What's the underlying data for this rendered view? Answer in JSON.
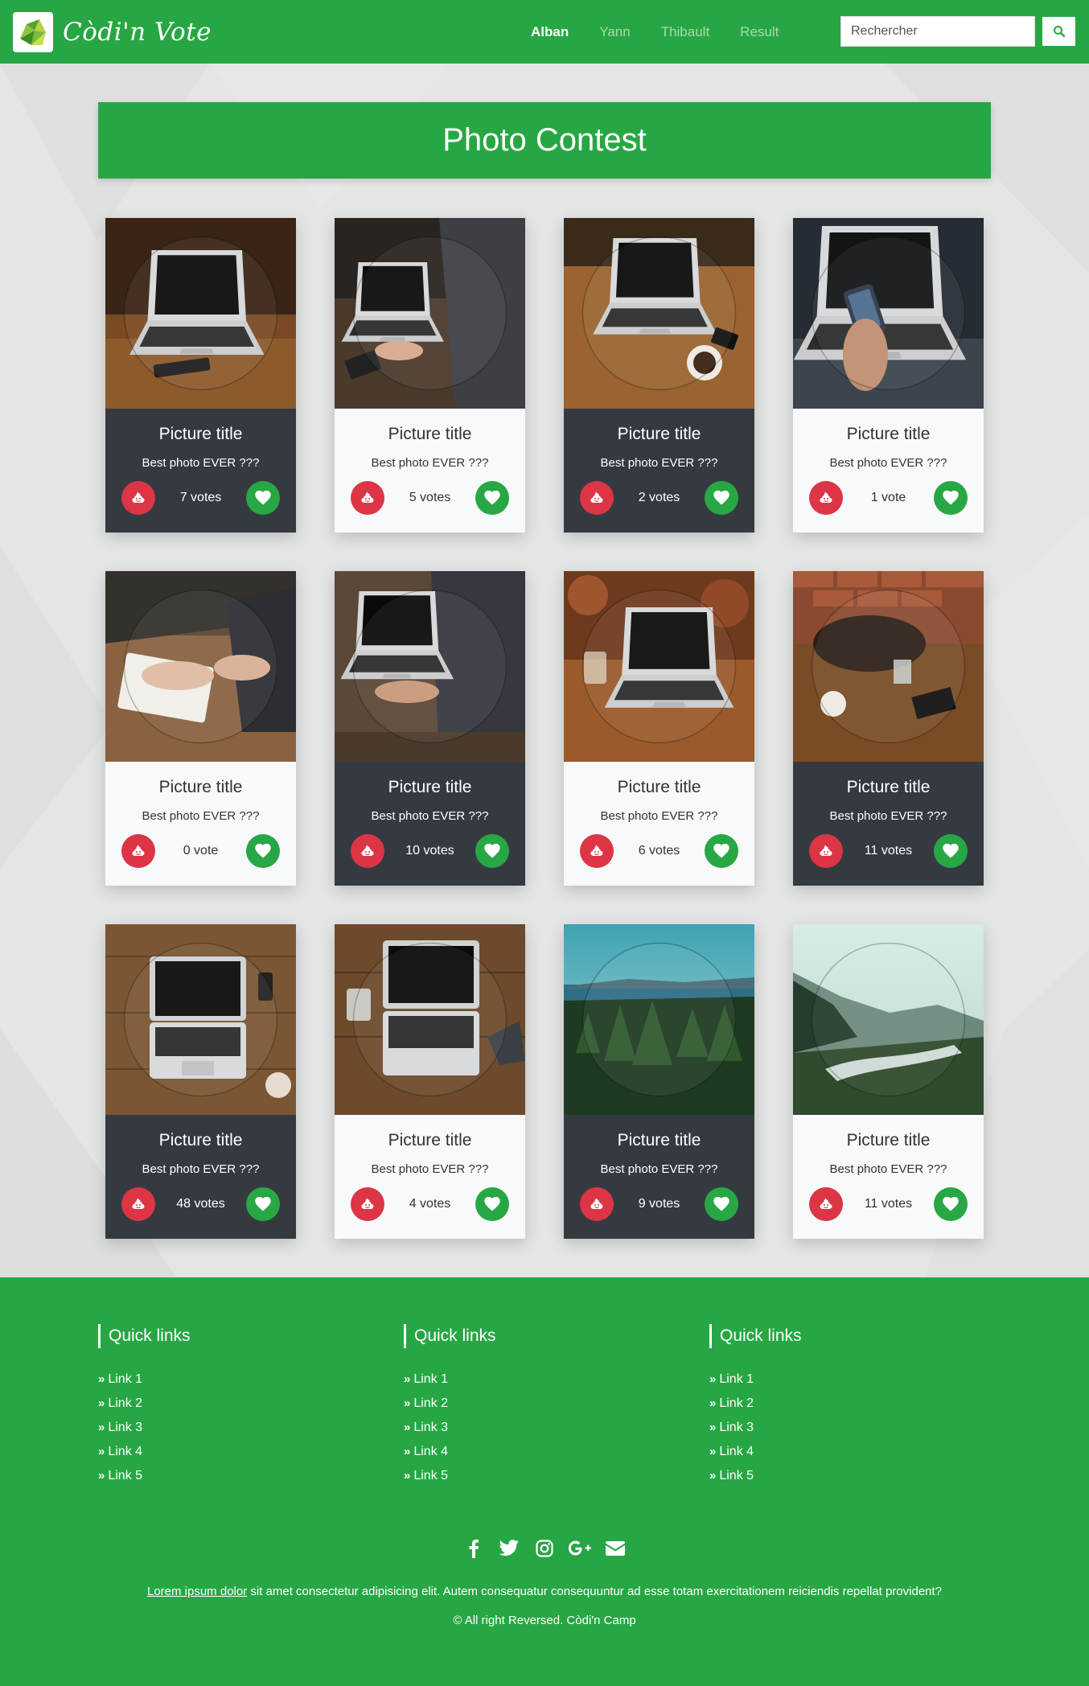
{
  "brand": {
    "name": "Còdi'n Vote"
  },
  "nav": {
    "links": [
      {
        "label": "Alban",
        "active": true
      },
      {
        "label": "Yann",
        "active": false
      },
      {
        "label": "Thibault",
        "active": false
      },
      {
        "label": "Result",
        "active": false
      }
    ],
    "search_placeholder": "Rechercher"
  },
  "banner": {
    "title": "Photo Contest"
  },
  "cards": [
    {
      "title": "Picture title",
      "subtitle": "Best photo EVER ???",
      "votes": "7 votes",
      "theme": "dark",
      "scene": "laptop-desk"
    },
    {
      "title": "Picture title",
      "subtitle": "Best photo EVER ???",
      "votes": "5 votes",
      "theme": "light",
      "scene": "laptop-typing"
    },
    {
      "title": "Picture title",
      "subtitle": "Best photo EVER ???",
      "votes": "2 votes",
      "theme": "dark",
      "scene": "laptop-coffee"
    },
    {
      "title": "Picture title",
      "subtitle": "Best photo EVER ???",
      "votes": "1 vote",
      "theme": "light",
      "scene": "laptop-phone"
    },
    {
      "title": "Picture title",
      "subtitle": "Best photo EVER ???",
      "votes": "0 vote",
      "theme": "light",
      "scene": "writing-notebook"
    },
    {
      "title": "Picture title",
      "subtitle": "Best photo EVER ???",
      "votes": "10 votes",
      "theme": "dark",
      "scene": "laptop-typing-2"
    },
    {
      "title": "Picture title",
      "subtitle": "Best photo EVER ???",
      "votes": "6 votes",
      "theme": "light",
      "scene": "laptop-bokeh"
    },
    {
      "title": "Picture title",
      "subtitle": "Best photo EVER ???",
      "votes": "11 votes",
      "theme": "dark",
      "scene": "bag-table"
    },
    {
      "title": "Picture title",
      "subtitle": "Best photo EVER ???",
      "votes": "48 votes",
      "theme": "dark",
      "scene": "laptop-topview"
    },
    {
      "title": "Picture title",
      "subtitle": "Best photo EVER ???",
      "votes": "4 votes",
      "theme": "light",
      "scene": "laptop-topview-2"
    },
    {
      "title": "Picture title",
      "subtitle": "Best photo EVER ???",
      "votes": "9 votes",
      "theme": "dark",
      "scene": "forest-lake"
    },
    {
      "title": "Picture title",
      "subtitle": "Best photo EVER ???",
      "votes": "11 votes",
      "theme": "light",
      "scene": "valley-river"
    }
  ],
  "footer": {
    "columns": [
      {
        "heading": "Quick links",
        "links": [
          "Link 1",
          "Link 2",
          "Link 3",
          "Link 4",
          "Link 5"
        ]
      },
      {
        "heading": "Quick links",
        "links": [
          "Link 1",
          "Link 2",
          "Link 3",
          "Link 4",
          "Link 5"
        ]
      },
      {
        "heading": "Quick links",
        "links": [
          "Link 1",
          "Link 2",
          "Link 3",
          "Link 4",
          "Link 5"
        ]
      }
    ],
    "social_icons": [
      "facebook-icon",
      "twitter-icon",
      "instagram-icon",
      "google-plus-icon",
      "envelope-icon"
    ],
    "lorem_link": "Lorem ipsum dolor",
    "lorem_rest": " sit amet consectetur adipisicing elit. Autem consequatur consequuntur ad esse totam exercitationem reiciendis repellat provident?",
    "copyright": "© All right Reversed.  Còdi'n Camp"
  },
  "colors": {
    "green": "#27a744",
    "dark": "#353a40",
    "light": "#f8f9fa",
    "red": "#dc3545"
  }
}
